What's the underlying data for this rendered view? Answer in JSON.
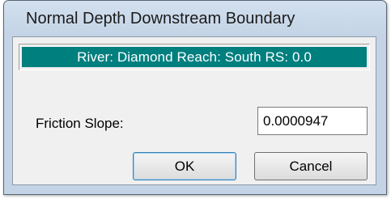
{
  "window": {
    "title": "Normal Depth Downstream Boundary"
  },
  "banner": {
    "text": "River: Diamond  Reach: South  RS: 0.0"
  },
  "friction_slope": {
    "label": "Friction Slope:",
    "value": "0.0000947"
  },
  "buttons": {
    "ok": "OK",
    "cancel": "Cancel"
  },
  "colors": {
    "banner_background": "#007f7f",
    "banner_text": "#ffffff",
    "window_frame": "#c4d4e6",
    "client_background": "#f0f0f0"
  }
}
